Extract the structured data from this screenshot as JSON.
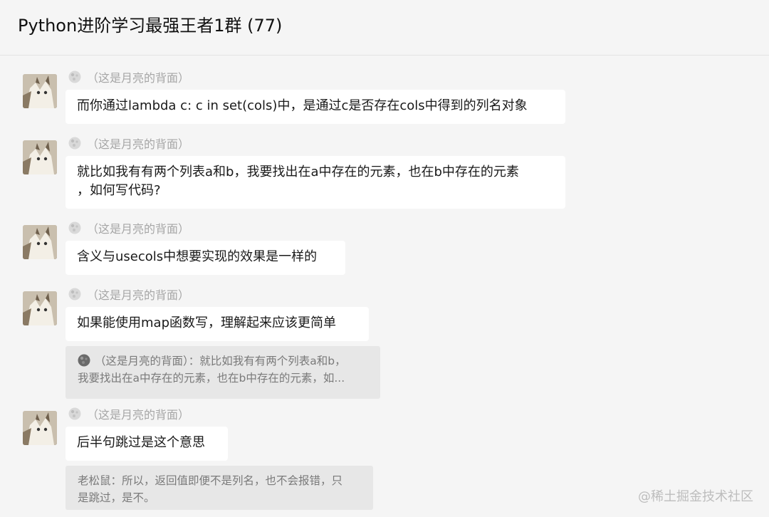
{
  "chat": {
    "title": "Python进阶学习最强王者1群 (77)"
  },
  "messages": [
    {
      "sender": "（这是月亮的背面）",
      "text": "而你通过lambda c: c in set(cols)中，是通过c是否存在cols中得到的列名对象"
    },
    {
      "sender": "（这是月亮的背面）",
      "text_line1": "就比如我有有两个列表a和b，我要找出在a中存在的元素，也在b中存在的元素",
      "text_line2": "，如何写代码?"
    },
    {
      "sender": "（这是月亮的背面）",
      "text": "含义与usecols中想要实现的效果是一样的"
    },
    {
      "sender": "（这是月亮的背面）",
      "text": "如果能使用map函数写，理解起来应该更简单",
      "quote_sender": "（这是月亮的背面）",
      "quote_line1": "：就比如我有有两个列表a和b，",
      "quote_line2": "我要找出在a中存在的元素，也在b中存在的元素，如..."
    },
    {
      "sender": "（这是月亮的背面）",
      "text": "后半句跳过是这个意思",
      "quote_line1": "老松鼠：所以，返回值即便不是列名，也不会报错，只",
      "quote_line2": "是跳过，是不。"
    }
  ],
  "watermark": "@稀土掘金技术社区",
  "icons": {
    "avatar": "cat-avatar",
    "sender": "moon-avatar-icon"
  }
}
